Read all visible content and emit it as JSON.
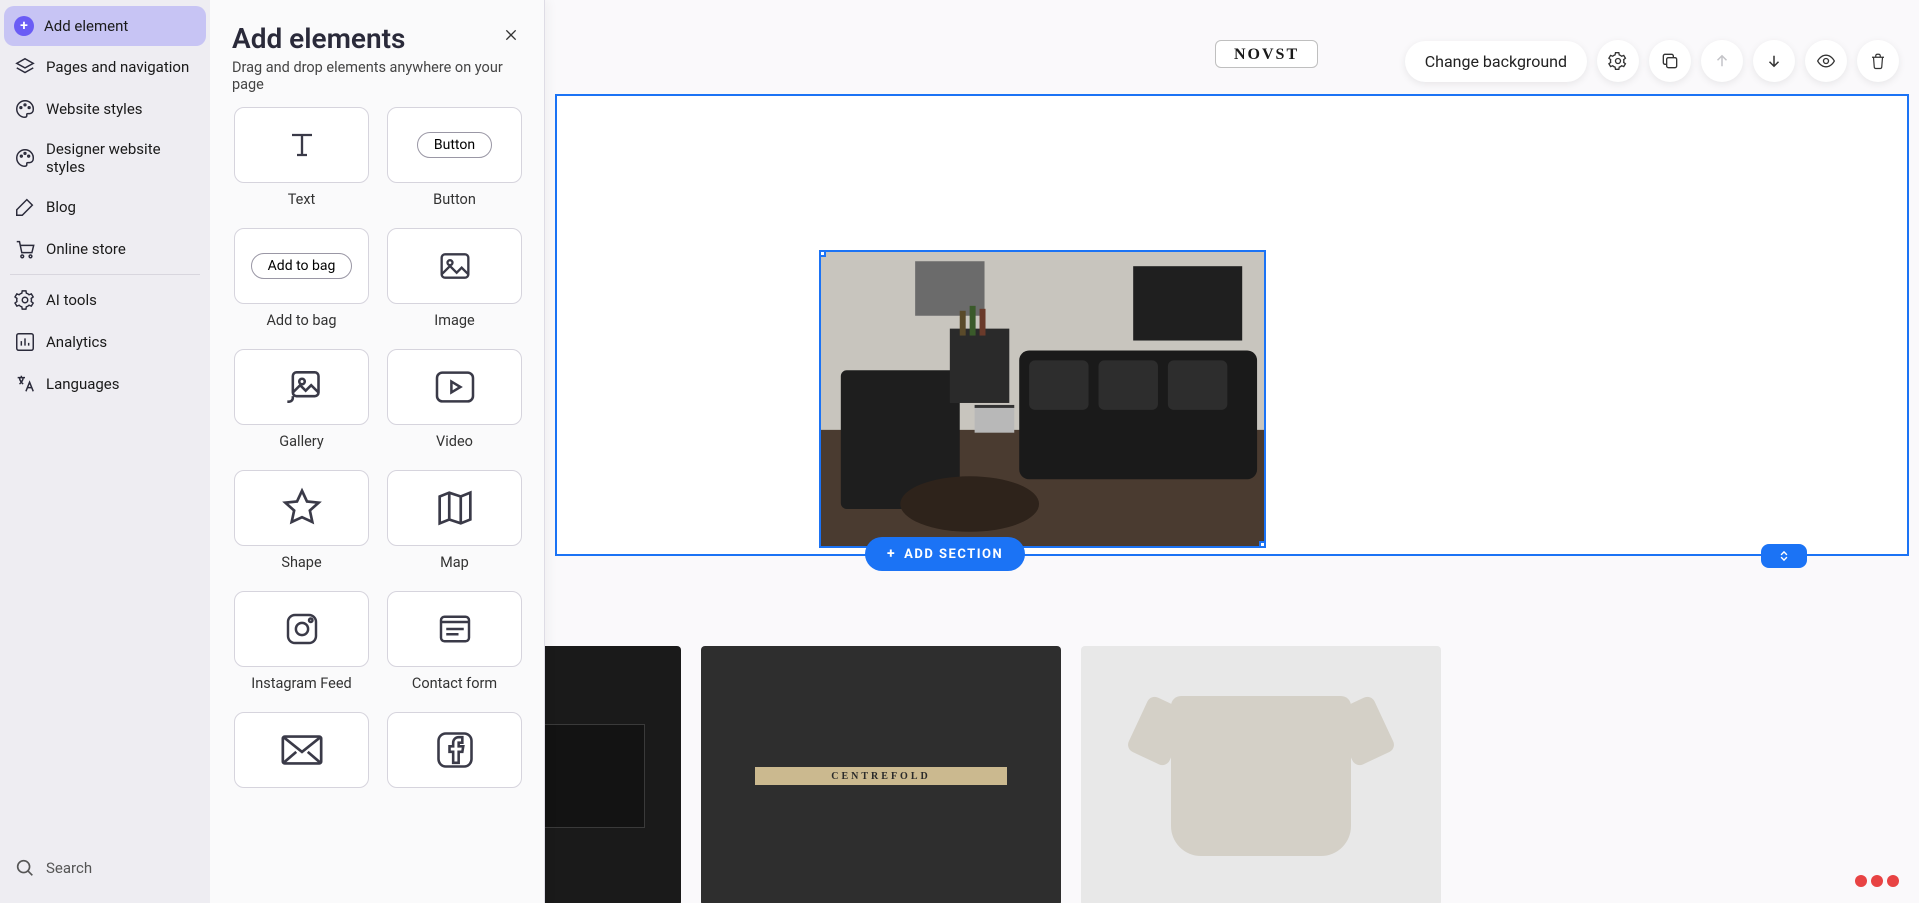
{
  "sidebar": {
    "add_element": "Add element",
    "items": [
      {
        "label": "Pages and navigation"
      },
      {
        "label": "Website styles"
      },
      {
        "label": "Designer website styles"
      },
      {
        "label": "Blog"
      },
      {
        "label": "Online store"
      }
    ],
    "items2": [
      {
        "label": "AI tools"
      },
      {
        "label": "Analytics"
      },
      {
        "label": "Languages"
      }
    ],
    "search": "Search"
  },
  "panel": {
    "title": "Add elements",
    "subtitle": "Drag and drop elements anywhere on your page",
    "elements": {
      "text": "Text",
      "button": "Button",
      "button_pill": "Button",
      "add_to_bag": "Add to bag",
      "add_to_bag_pill": "Add to bag",
      "image": "Image",
      "gallery": "Gallery",
      "video": "Video",
      "shape": "Shape",
      "map": "Map",
      "instagram": "Instagram Feed",
      "contact_form": "Contact form"
    }
  },
  "toolbar": {
    "change_bg": "Change background"
  },
  "canvas": {
    "brand": "NOVST",
    "add_section": "ADD SECTION",
    "centrefold": "CENTREFOLD"
  }
}
